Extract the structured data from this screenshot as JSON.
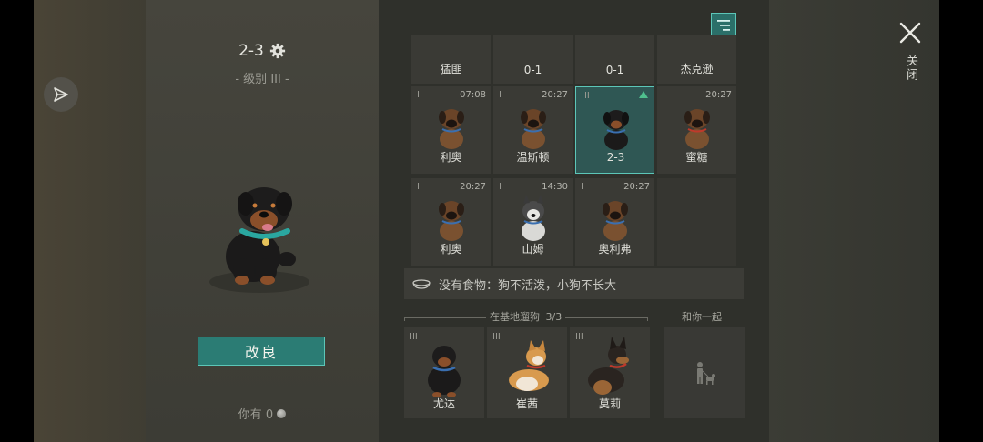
{
  "header": {
    "dog_title": "2-3",
    "dog_level": "- 级别 III -"
  },
  "left": {
    "improve_label": "改良",
    "you_have_label": "你有 0"
  },
  "grid": {
    "top_row": [
      {
        "name": "猛匪"
      },
      {
        "name": "0-1"
      },
      {
        "name": "0-1"
      },
      {
        "name": "杰克逊"
      }
    ],
    "row2": [
      {
        "level": "I",
        "time": "07:08",
        "name": "利奥"
      },
      {
        "level": "I",
        "time": "20:27",
        "name": "温斯顿"
      },
      {
        "level": "III",
        "time": "",
        "name": "2-3",
        "upgradable": true
      },
      {
        "level": "I",
        "time": "20:27",
        "name": "蜜糖"
      }
    ],
    "row3": [
      {
        "level": "I",
        "time": "20:27",
        "name": "利奥"
      },
      {
        "level": "I",
        "time": "14:30",
        "name": "山姆"
      },
      {
        "level": "I",
        "time": "20:27",
        "name": "奥利弗"
      }
    ]
  },
  "food_message": "没有食物：狗不活泼，小狗不长大",
  "walking": {
    "label": "在基地遛狗",
    "count": "3/3",
    "dogs": [
      {
        "level": "III",
        "name": "尤达"
      },
      {
        "level": "III",
        "name": "崔茜"
      },
      {
        "level": "III",
        "name": "莫莉"
      }
    ]
  },
  "with_you_label": "和你一起",
  "close_label": "关闭",
  "colors": {
    "accent": "#5cc6b8",
    "button": "#2b7c74",
    "selected_cell": "#2f5754"
  }
}
